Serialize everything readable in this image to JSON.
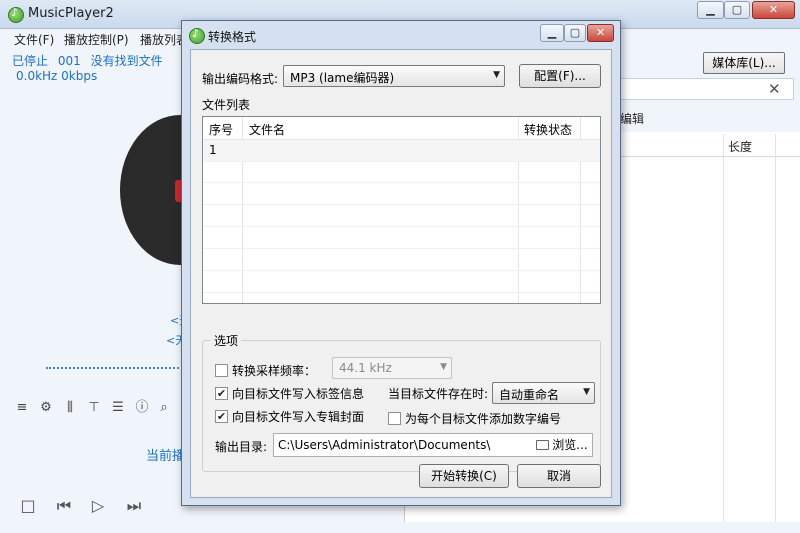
{
  "main_window": {
    "title": "MusicPlayer2",
    "menu": [
      "文件(F)",
      "播放控制(P)",
      "播放列表"
    ],
    "status": {
      "state": "已停止",
      "track_no": "001",
      "message": "没有找到文件"
    },
    "audio_info": "0.0kHz 0kbps",
    "lyric_line_1": "<无",
    "lyric_line_2": "<无",
    "now_playing_label": "当前播",
    "media_library_button": "媒体库(L)...",
    "right_pane": {
      "edit_label": "编辑",
      "length_header": "长度"
    },
    "toolbar_icons": [
      "equalizer-icon",
      "settings-icon",
      "mixer-icon",
      "skin-icon",
      "menu-icon",
      "info-icon",
      "search-icon"
    ],
    "controls": [
      "stop-icon",
      "previous-icon",
      "play-icon",
      "next-icon"
    ]
  },
  "dialog": {
    "title": "转换格式",
    "encoder_label": "输出编码格式:",
    "encoder_value": "MP3 (lame编码器)",
    "config_button": "配置(F)...",
    "file_list_label": "文件列表",
    "file_table": {
      "columns": [
        "序号",
        "文件名",
        "转换状态"
      ],
      "rows": [
        {
          "index": "1",
          "name": "",
          "status": ""
        }
      ]
    },
    "options_title": "选项",
    "resample_label": "转换采样频率：",
    "resample_checked": false,
    "resample_value": "44.1 kHz",
    "write_tags_label": "向目标文件写入标签信息",
    "write_tags_checked": true,
    "write_cover_label": "向目标文件写入专辑封面",
    "write_cover_checked": true,
    "exists_label": "当目标文件存在时:",
    "exists_value": "自动重命名",
    "add_number_label": "为每个目标文件添加数字编号",
    "add_number_checked": false,
    "output_dir_label": "输出目录:",
    "output_dir_value": "C:\\Users\\Administrator\\Documents\\",
    "browse_button": "浏览...",
    "start_button": "开始转换(C)",
    "cancel_button": "取消"
  }
}
